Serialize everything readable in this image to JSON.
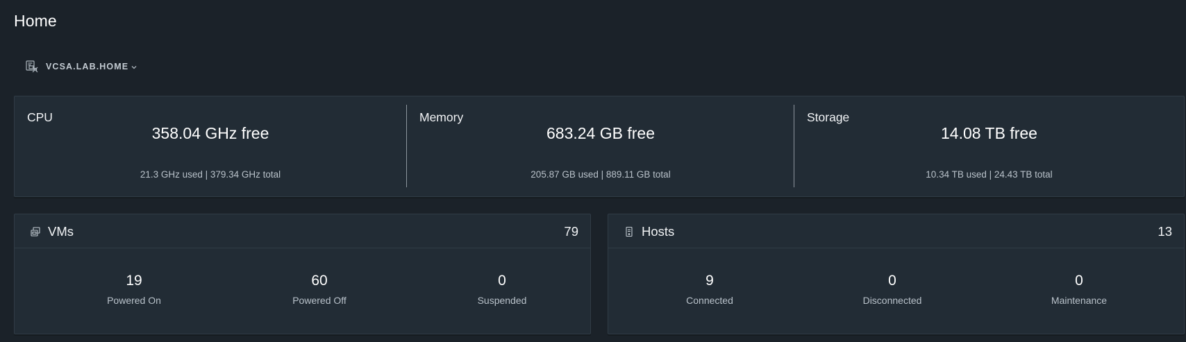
{
  "page": {
    "title": "Home"
  },
  "vcenter": {
    "name": "VCSA.LAB.HOME",
    "icon": "vcenter-icon"
  },
  "capacity": {
    "cpu": {
      "title": "CPU",
      "free": "358.04 GHz free",
      "detail": "21.3 GHz used | 379.34 GHz total"
    },
    "memory": {
      "title": "Memory",
      "free": "683.24 GB free",
      "detail": "205.87 GB used | 889.11 GB total"
    },
    "storage": {
      "title": "Storage",
      "free": "14.08 TB free",
      "detail": "10.34 TB used | 24.43 TB total"
    }
  },
  "vms": {
    "title": "VMs",
    "icon": "vms-icon",
    "total": "79",
    "stats": [
      {
        "value": "19",
        "label": "Powered On"
      },
      {
        "value": "60",
        "label": "Powered Off"
      },
      {
        "value": "0",
        "label": "Suspended"
      }
    ]
  },
  "hosts": {
    "title": "Hosts",
    "icon": "host-icon",
    "total": "13",
    "stats": [
      {
        "value": "9",
        "label": "Connected"
      },
      {
        "value": "0",
        "label": "Disconnected"
      },
      {
        "value": "0",
        "label": "Maintenance"
      }
    ]
  },
  "colors": {
    "background": "#1b2229",
    "card": "#222c35",
    "border": "#313c46",
    "text": "#ffffff",
    "muted_text": "#b9c2ca"
  }
}
